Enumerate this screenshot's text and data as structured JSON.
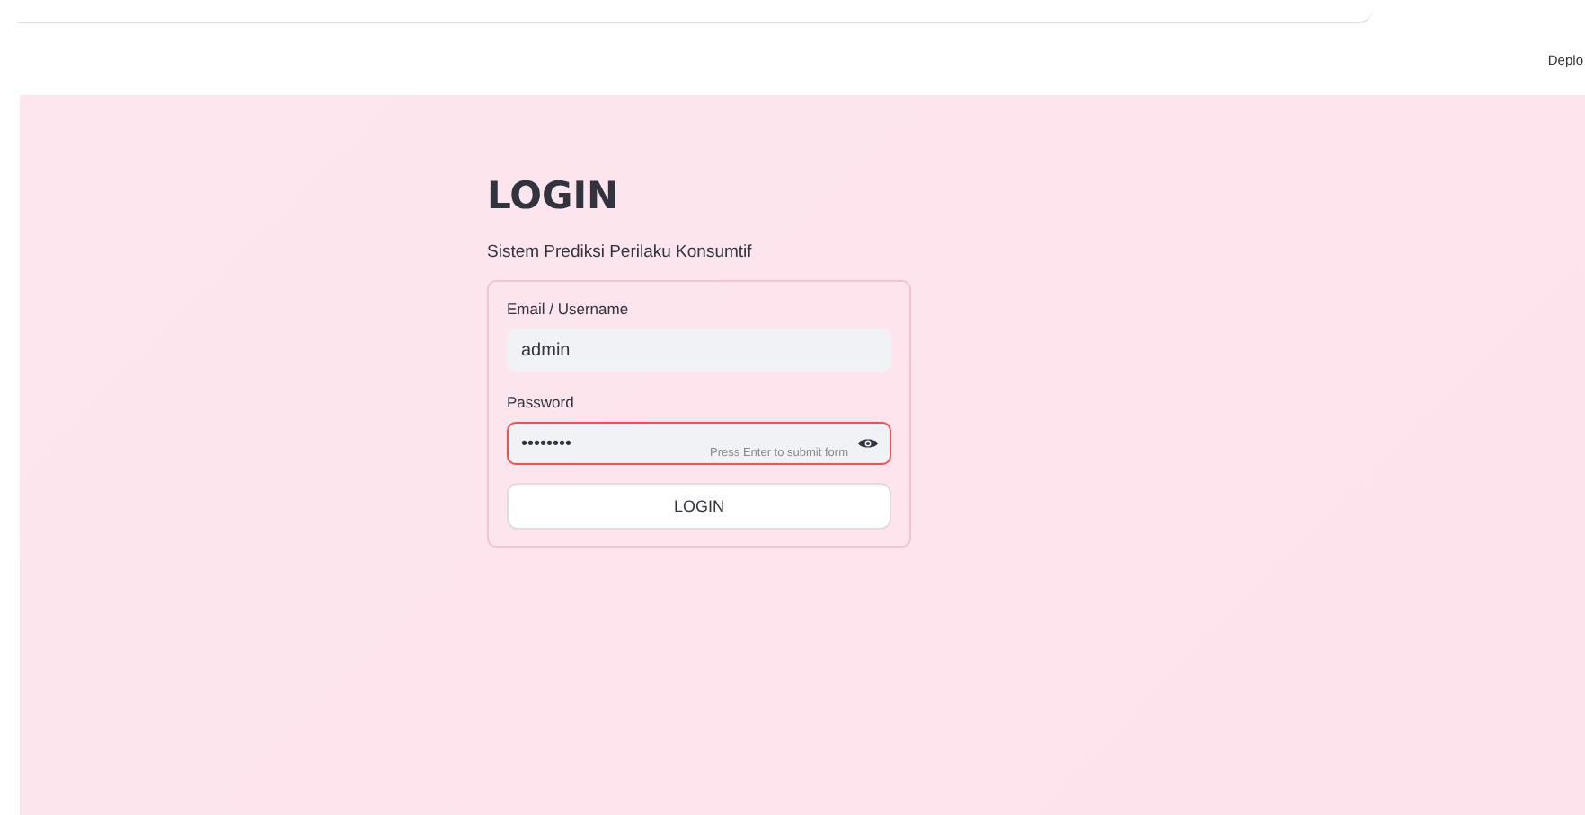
{
  "header": {
    "deploy_label": "Deplo"
  },
  "title": "LOGIN",
  "subtitle": "Sistem Prediksi Perilaku Konsumtif",
  "form": {
    "fields": [
      {
        "label": "Email / Username",
        "value": "admin",
        "kind": "text",
        "focused": false
      },
      {
        "label": "Password",
        "value": "••••••••",
        "kind": "password",
        "focused": true,
        "hint": "Press Enter to submit form"
      }
    ],
    "submit": "LOGIN"
  }
}
